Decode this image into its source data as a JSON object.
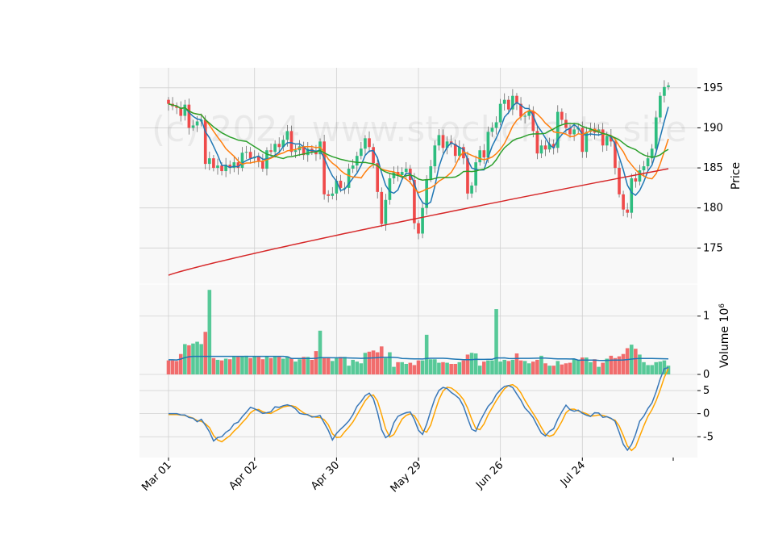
{
  "watermark": "(c) 2024 www.stockcharts.site",
  "colors": {
    "up": "#2ebd7f",
    "down": "#ef4a4a",
    "panel_bg": "#f8f8f8",
    "grid": "#d0d0d0",
    "ma_short": "#1f77b4",
    "ma_mid": "#ff7f0e",
    "ma_long": "#2ca02c",
    "ma_200": "#d62728",
    "volume_ma": "#1f77b4",
    "osc_line": "#3a78b8",
    "osc_signal": "#ffa500"
  },
  "chart_data": [
    {
      "type": "candlestick",
      "panel": "price",
      "ylabel": "Price",
      "ylim": [
        170.5,
        197.5
      ],
      "yticks": [
        175,
        180,
        185,
        190,
        195
      ],
      "xticks": [
        "Mar 01",
        "Apr 02",
        "Apr 30",
        "May 29",
        "Jun 26",
        "Jul 24"
      ],
      "xtick_index": [
        0,
        21,
        41,
        61,
        81,
        101
      ],
      "grid": true,
      "series_lines": [
        "ma_short",
        "ma_mid",
        "ma_long",
        "ma_200"
      ],
      "close": [
        193.0,
        192.7,
        192.5,
        191.5,
        192.9,
        190.0,
        190.3,
        190.8,
        191.0,
        185.5,
        186.2,
        185.0,
        185.3,
        184.6,
        185.4,
        185.0,
        185.7,
        185.0,
        186.9,
        187.0,
        186.2,
        186.4,
        185.9,
        184.9,
        187.2,
        187.0,
        188.0,
        187.6,
        188.5,
        189.6,
        187.0,
        187.2,
        187.7,
        186.6,
        187.4,
        187.0,
        186.7,
        188.3,
        181.7,
        181.5,
        181.8,
        183.4,
        182.5,
        182.5,
        184.9,
        185.3,
        186.5,
        187.4,
        188.7,
        187.6,
        185.6,
        182.0,
        178.0,
        181.0,
        183.7,
        184.5,
        184.1,
        184.5,
        184.9,
        183.5,
        178.1,
        176.8,
        180.0,
        183.6,
        185.2,
        187.8,
        189.1,
        187.5,
        188.3,
        188.0,
        186.5,
        187.6,
        186.2,
        181.8,
        182.8,
        185.7,
        187.2,
        186.3,
        189.5,
        190.0,
        190.7,
        193.0,
        193.5,
        192.3,
        194.0,
        193.0,
        191.4,
        191.5,
        192.1,
        189.6,
        186.8,
        187.8,
        187.3,
        188.0,
        187.5,
        192.0,
        191.0,
        190.0,
        189.2,
        189.8,
        190.0,
        187.0,
        189.5,
        189.9,
        189.4,
        189.8,
        187.8,
        189.0,
        188.3,
        185.0,
        181.7,
        179.8,
        179.4,
        183.7,
        183.3,
        184.7,
        185.2,
        186.2,
        187.4,
        191.3,
        194.0,
        195.1,
        195.3
      ],
      "volume_unit": "1e6",
      "volume": [
        0.24,
        0.24,
        0.23,
        0.35,
        0.52,
        0.5,
        0.53,
        0.56,
        0.52,
        0.73,
        1.45,
        0.28,
        0.25,
        0.24,
        0.27,
        0.26,
        0.3,
        0.3,
        0.31,
        0.32,
        0.28,
        0.31,
        0.3,
        0.26,
        0.31,
        0.28,
        0.31,
        0.3,
        0.27,
        0.31,
        0.28,
        0.22,
        0.26,
        0.3,
        0.3,
        0.25,
        0.4,
        0.75,
        0.29,
        0.28,
        0.23,
        0.29,
        0.3,
        0.3,
        0.15,
        0.25,
        0.22,
        0.19,
        0.37,
        0.39,
        0.41,
        0.38,
        0.48,
        0.28,
        0.38,
        0.13,
        0.21,
        0.21,
        0.18,
        0.2,
        0.16,
        0.24,
        0.24,
        0.68,
        0.26,
        0.26,
        0.2,
        0.21,
        0.2,
        0.18,
        0.18,
        0.21,
        0.24,
        0.34,
        0.37,
        0.36,
        0.15,
        0.22,
        0.24,
        0.24,
        1.12,
        0.22,
        0.25,
        0.23,
        0.25,
        0.36,
        0.24,
        0.23,
        0.19,
        0.22,
        0.25,
        0.32,
        0.19,
        0.15,
        0.15,
        0.23,
        0.17,
        0.19,
        0.2,
        0.27,
        0.25,
        0.29,
        0.29,
        0.21,
        0.26,
        0.13,
        0.2,
        0.27,
        0.32,
        0.28,
        0.31,
        0.35,
        0.45,
        0.51,
        0.44,
        0.34,
        0.21,
        0.16,
        0.16,
        0.21,
        0.22,
        0.24,
        0.15
      ],
      "volume_ylim": [
        0,
        1.55
      ],
      "volume_yticks": [
        0,
        1
      ],
      "volume_ylabel": "Volume  $10^6$",
      "osc_ylim": [
        -9.5,
        8.5
      ],
      "osc_yticks": [
        -5,
        0,
        5
      ]
    }
  ]
}
